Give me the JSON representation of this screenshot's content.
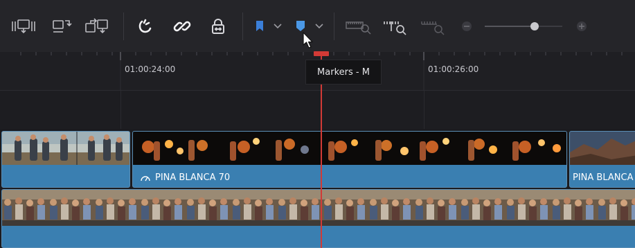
{
  "toolbar": {
    "tools": [
      {
        "name": "insert-clip-icon"
      },
      {
        "name": "overwrite-clip-icon"
      },
      {
        "name": "replace-clip-icon"
      },
      {
        "name": "snapping-icon"
      },
      {
        "name": "link-icon"
      },
      {
        "name": "position-lock-icon"
      },
      {
        "name": "flag-icon"
      },
      {
        "name": "marker-icon"
      },
      {
        "name": "full-extent-zoom-icon"
      },
      {
        "name": "detail-zoom-icon"
      },
      {
        "name": "custom-zoom-icon"
      }
    ],
    "zoom_level": 0.64,
    "colors": {
      "flag": "#3b7fd9",
      "marker": "#4b98e6",
      "icon": "#bdbdc2",
      "dim_icon": "#5b5b61"
    }
  },
  "ruler": {
    "timecodes": [
      "01:00:24:00",
      "01:00:26:00"
    ]
  },
  "tooltip": {
    "text": "Markers - M"
  },
  "tracks": {
    "v2": {
      "clips": [
        {
          "label": ""
        },
        {
          "label": "PINA BLANCA 70",
          "icon": "speed-change-icon"
        },
        {
          "label": "PINA BLANCA"
        }
      ]
    },
    "v1": {
      "clips": [
        {
          "label": ""
        }
      ]
    }
  },
  "playhead": {
    "color": "#d23a36"
  }
}
